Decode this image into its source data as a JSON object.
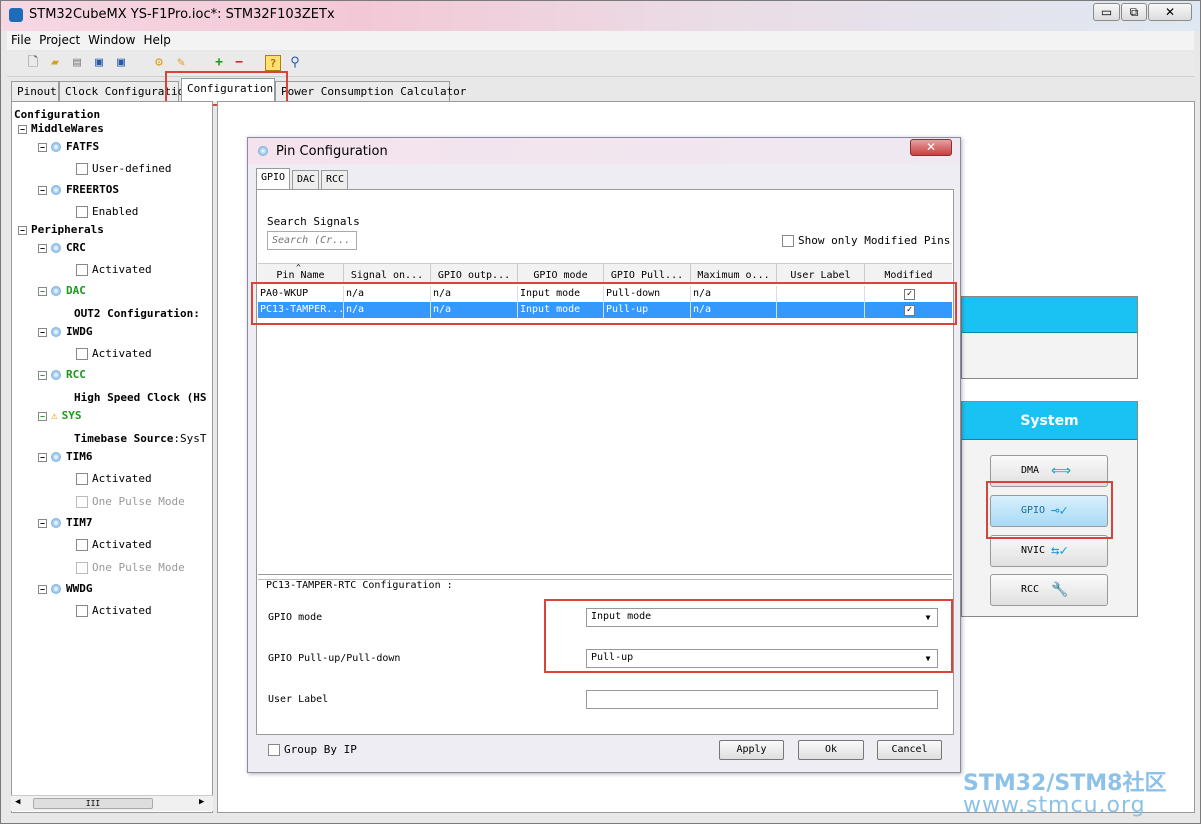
{
  "window": {
    "title": "STM32CubeMX YS-F1Pro.ioc*: STM32F103ZETx",
    "minimize_glyph": "▭",
    "restore_glyph": "⧉",
    "close_glyph": "✕"
  },
  "menu": [
    "File",
    "Project",
    "Window",
    "Help"
  ],
  "tabs": [
    "Pinout",
    "Clock Configuration",
    "Configuration",
    "Power Consumption Calculator"
  ],
  "tree": {
    "root": "Configuration",
    "middlewares": "MiddleWares",
    "fatfs": "FATFS",
    "fatfs_user_defined": "User-defined",
    "freertos": "FREERTOS",
    "freertos_enabled": "Enabled",
    "peripherals": "Peripherals",
    "crc": "CRC",
    "crc_activated": "Activated",
    "dac": "DAC",
    "dac_out2": "OUT2 Configuration:",
    "iwdg": "IWDG",
    "iwdg_activated": "Activated",
    "rcc": "RCC",
    "rcc_hse": "High Speed Clock (HS",
    "sys": "SYS",
    "sys_timebase_label": "Timebase Source",
    "sys_timebase_value": ":SysT",
    "tim6": "TIM6",
    "tim6_activated": "Activated",
    "tim6_onepulse": "One Pulse Mode",
    "tim7": "TIM7",
    "tim7_activated": "Activated",
    "tim7_onepulse": "One Pulse Mode",
    "wwdg": "WWDG",
    "wwdg_activated": "Activated",
    "scroll_thumb": "III"
  },
  "system": {
    "header": "System",
    "dma": "DMA",
    "gpio": "GPIO",
    "nvic": "NVIC",
    "rcc": "RCC"
  },
  "dialog": {
    "title": "Pin Configuration",
    "close_glyph": "✕",
    "tabs": [
      "GPIO",
      "DAC",
      "RCC"
    ],
    "search_label": "Search Signals",
    "search_placeholder": "Search (Cr...",
    "show_modified": "Show only Modified Pins",
    "columns": [
      "Pin Name",
      "Signal on...",
      "GPIO outp...",
      "GPIO mode",
      "GPIO Pull...",
      "Maximum o...",
      "User Label",
      "Modified"
    ],
    "rows": [
      {
        "pin": "PA0-WKUP",
        "signal": "n/a",
        "output": "n/a",
        "mode": "Input mode",
        "pull": "Pull-down",
        "max": "n/a",
        "label": "",
        "modified": "✓"
      },
      {
        "pin": "PC13-TAMPER...",
        "signal": "n/a",
        "output": "n/a",
        "mode": "Input mode",
        "pull": "Pull-up",
        "max": "n/a",
        "label": "",
        "modified": "✓"
      }
    ],
    "config_title": "PC13-TAMPER-RTC Configuration :",
    "gpio_mode_label": "GPIO mode",
    "gpio_mode_value": "Input mode",
    "gpio_pull_label": "GPIO Pull-up/Pull-down",
    "gpio_pull_value": "Pull-up",
    "user_label_label": "User Label",
    "user_label_value": "",
    "group_by_ip": "Group By IP",
    "apply": "Apply",
    "ok": "Ok",
    "cancel": "Cancel"
  },
  "watermark": {
    "line1": "STM32/STM8社区",
    "line2": "www.stmcu.org"
  }
}
